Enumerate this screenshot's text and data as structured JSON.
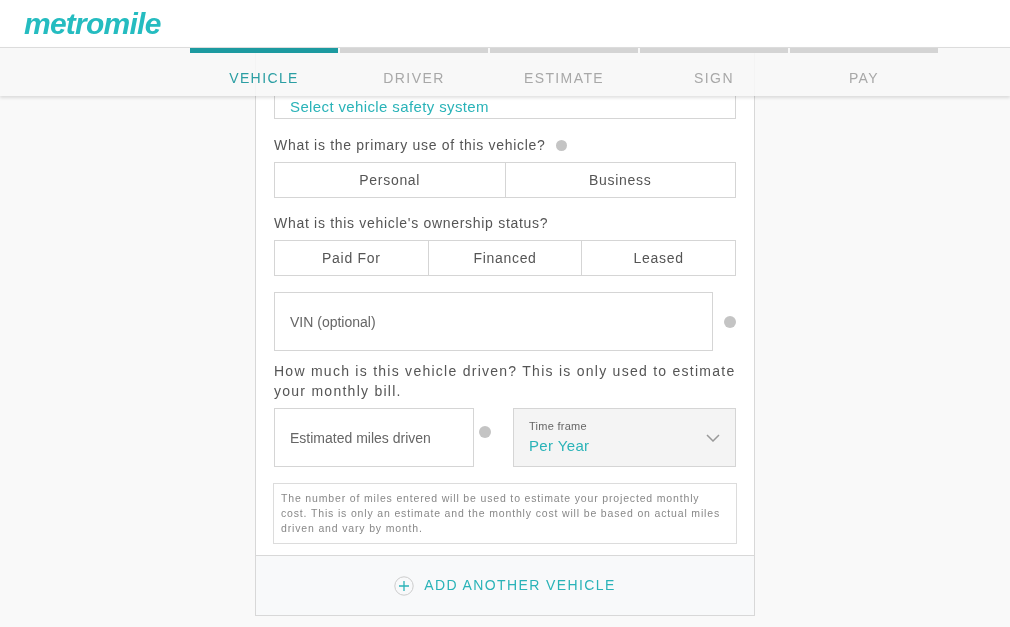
{
  "logo": "metromile",
  "steps": [
    {
      "label": "VEHICLE",
      "selected": true
    },
    {
      "label": "DRIVER",
      "selected": false
    },
    {
      "label": "ESTIMATE",
      "selected": false
    },
    {
      "label": "SIGN",
      "selected": false
    },
    {
      "label": "PAY",
      "selected": false
    }
  ],
  "safety_select": {
    "value": "Select vehicle safety system"
  },
  "primary_use": {
    "question": "What is the primary use of this vehicle?",
    "options": [
      {
        "label": "Personal",
        "selected": false
      },
      {
        "label": "Business",
        "selected": false
      }
    ]
  },
  "ownership": {
    "question": "What is this vehicle's ownership status?",
    "options": [
      {
        "label": "Paid For",
        "selected": false
      },
      {
        "label": "Financed",
        "selected": false
      },
      {
        "label": "Leased",
        "selected": false
      }
    ]
  },
  "vin": {
    "placeholder": "VIN (optional)"
  },
  "mileage_question": "How much is this vehicle driven? This is only used to estimate your monthly bill.",
  "miles": {
    "placeholder": "Estimated miles driven"
  },
  "time_frame": {
    "label": "Time frame",
    "value": "Per Year"
  },
  "note": "The number of miles entered will be used to estimate your projected monthly cost. This is only an estimate and the monthly cost will be based on actual miles driven and vary by month.",
  "add_vehicle": "ADD ANOTHER VEHICLE"
}
